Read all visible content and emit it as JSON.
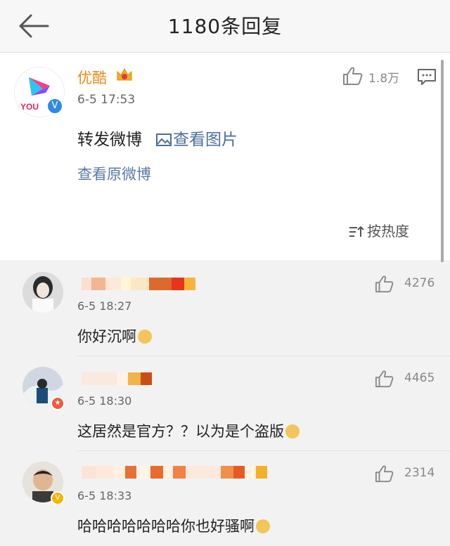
{
  "header": {
    "title": "1180条回复",
    "back_icon": "back-arrow-icon"
  },
  "post": {
    "author": "优酷",
    "avatar_text": "YOU",
    "time": "6-5 17:53",
    "likes": "1.8万",
    "text": "转发微博",
    "pic_link": "查看图片",
    "original_link": "查看原微博",
    "sort_label": "按热度",
    "colors": {
      "author": "#e98b15",
      "link": "#4a6e9e",
      "verified": "#2e8ae6"
    }
  },
  "comments": [
    {
      "time": "6-5 18:27",
      "likes": "4276",
      "text": "你好沉啊",
      "emoji": "doge-emoji"
    },
    {
      "time": "6-5 18:30",
      "likes": "4465",
      "text": "这居然是官方？？以为是个盗版",
      "emoji": "laugh-cry-emoji"
    },
    {
      "time": "6-5 18:33",
      "likes": "2314",
      "text": "哈哈哈哈哈哈哈你也好骚啊",
      "emoji": "doge-emoji"
    }
  ]
}
